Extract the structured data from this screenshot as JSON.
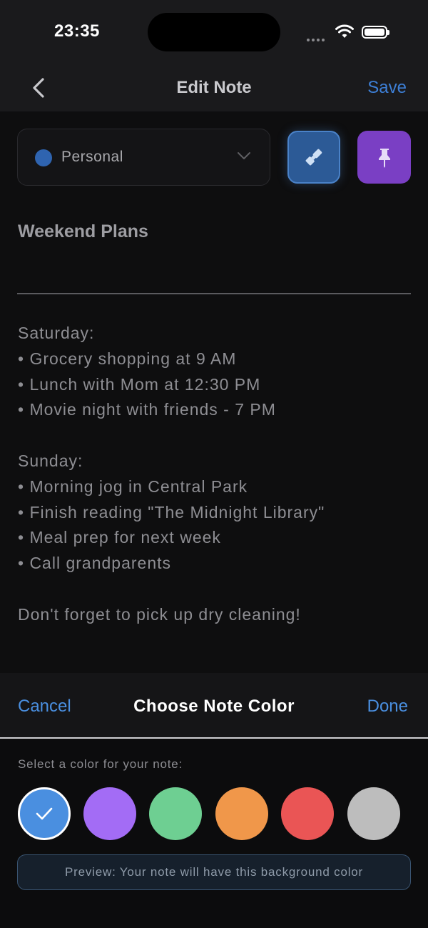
{
  "status_bar": {
    "time": "23:35"
  },
  "nav": {
    "title": "Edit Note",
    "save_label": "Save"
  },
  "category": {
    "label": "Personal",
    "dot_color": "#2f64b0"
  },
  "toolbar": {
    "brush_icon": "paintbrush-icon",
    "pin_icon": "pin-icon"
  },
  "note": {
    "title": "Weekend Plans",
    "body": "Saturday:\n• Grocery shopping at 9 AM\n• Lunch with Mom at 12:30 PM\n• Movie night with friends - 7 PM\n\nSunday:\n• Morning jog in Central Park\n• Finish reading \"The Midnight Library\"\n• Meal prep for next week\n• Call grandparents\n\nDon't forget to pick up dry cleaning!"
  },
  "color_sheet": {
    "cancel_label": "Cancel",
    "title": "Choose Note Color",
    "done_label": "Done",
    "prompt": "Select a color for your note:",
    "colors": [
      "#4a8fe0",
      "#a36cf5",
      "#6ecf92",
      "#f0974a",
      "#ea5555",
      "#bdbdbd"
    ],
    "selected_color": "#4a8fe0",
    "preview_text": "Preview: Your note will have this background color"
  }
}
